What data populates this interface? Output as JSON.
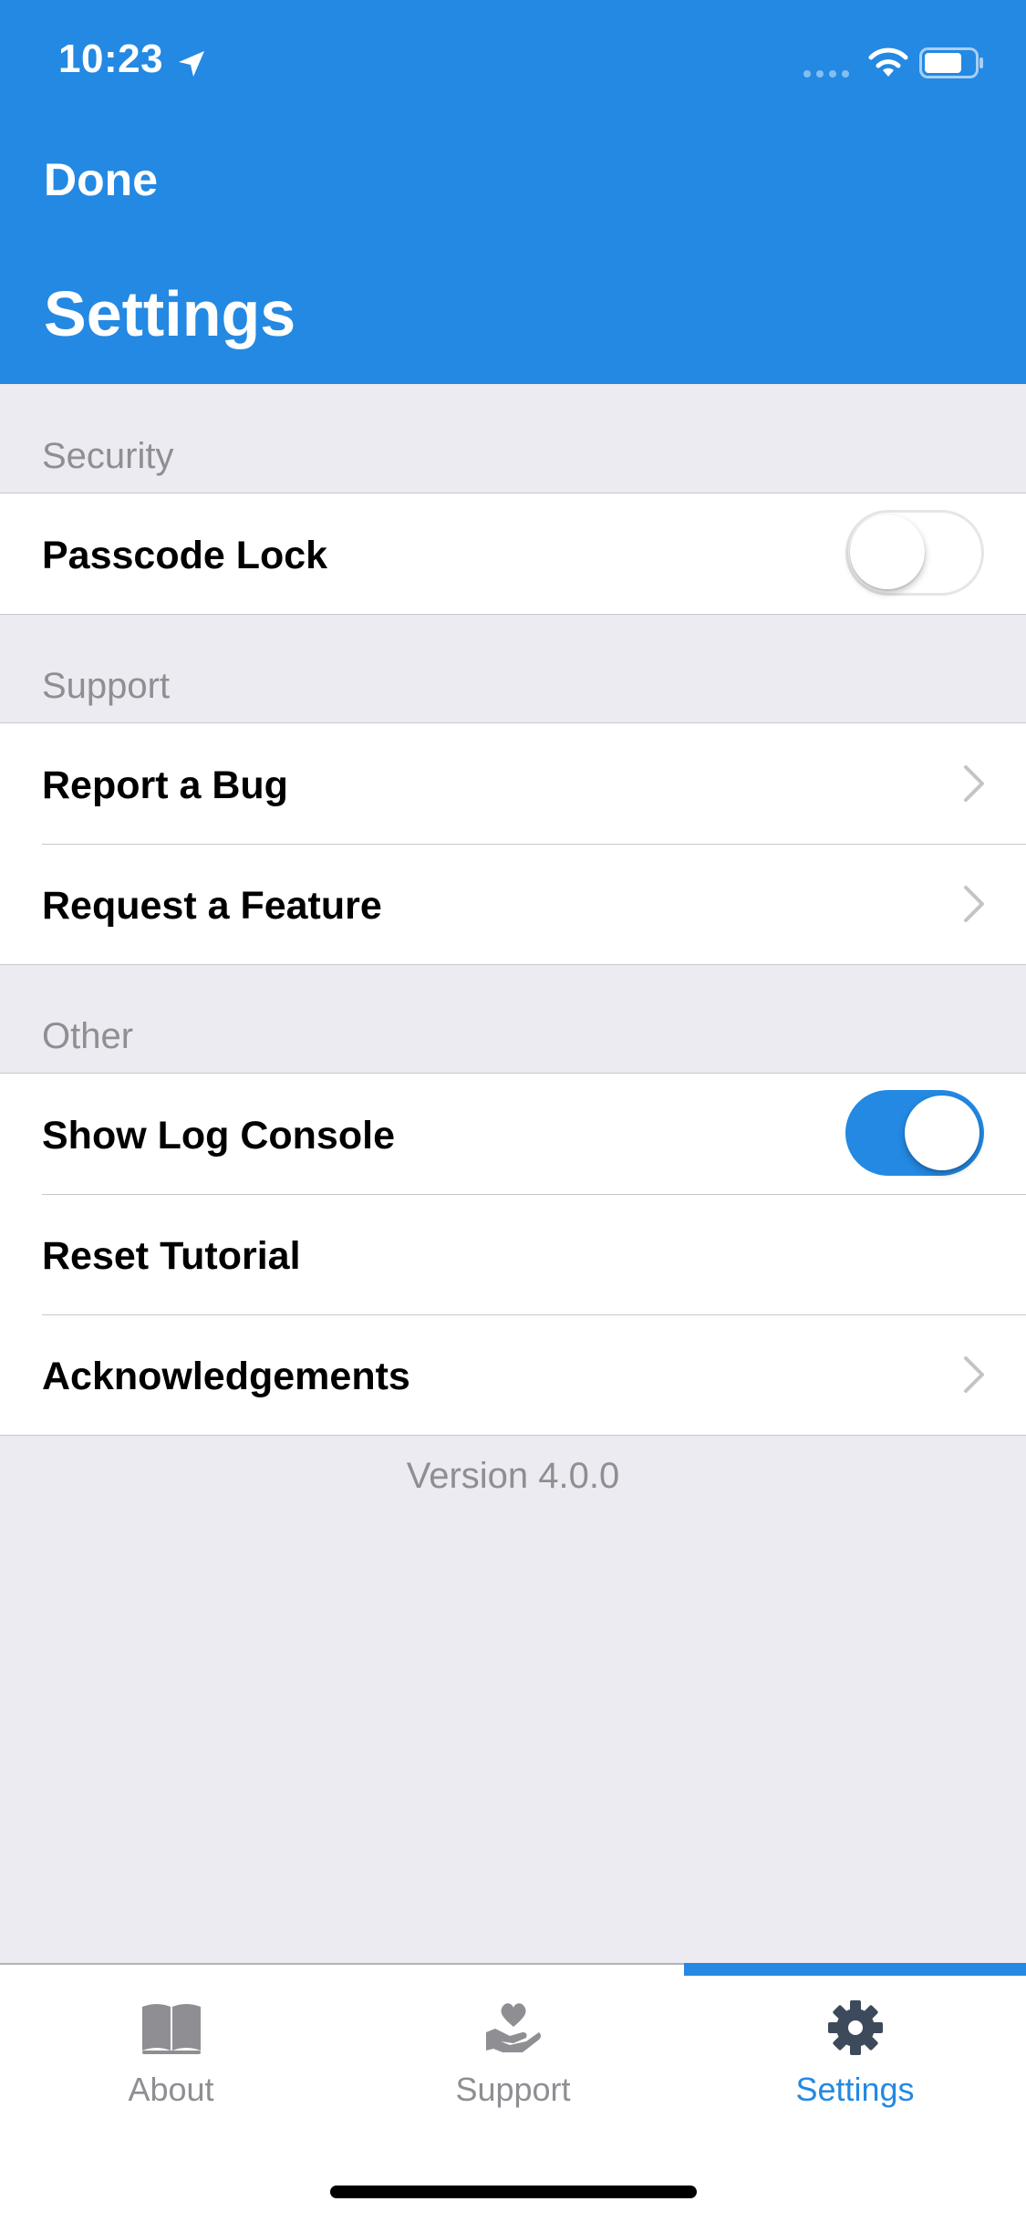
{
  "status_bar": {
    "time": "10:23"
  },
  "header": {
    "done_label": "Done",
    "title": "Settings"
  },
  "sections": {
    "security": {
      "label": "Security",
      "rows": [
        {
          "label": "Passcode Lock",
          "toggle": false
        }
      ]
    },
    "support": {
      "label": "Support",
      "rows": [
        {
          "label": "Report a Bug"
        },
        {
          "label": "Request a Feature"
        }
      ]
    },
    "other": {
      "label": "Other",
      "rows": [
        {
          "label": "Show Log Console",
          "toggle": true
        },
        {
          "label": "Reset Tutorial"
        },
        {
          "label": "Acknowledgements"
        }
      ]
    }
  },
  "version": "Version 4.0.0",
  "tabbar": {
    "tabs": [
      {
        "label": "About",
        "icon": "book-icon"
      },
      {
        "label": "Support",
        "icon": "heart-hand-icon"
      },
      {
        "label": "Settings",
        "icon": "gear-icon"
      }
    ],
    "active": 2
  },
  "colors": {
    "accent": "#2389E3",
    "background": "#EBEBF1",
    "secondary_text": "#8E8E93"
  }
}
